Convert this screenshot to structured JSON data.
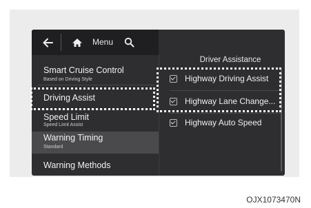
{
  "topbar": {
    "back_icon": "back-arrow-icon",
    "home_icon": "home-icon",
    "menu_label": "Menu",
    "search_icon": "search-icon"
  },
  "left_menu": [
    {
      "label": "Smart Cruise Control",
      "sub": "Based on Driving Style"
    },
    {
      "label": "Driving Assist",
      "sub": ""
    },
    {
      "label": "Speed Limit",
      "sub": "Speed Limit Assist"
    },
    {
      "label": "Warning Timing",
      "sub": "Standard"
    },
    {
      "label": "Warning Methods",
      "sub": ""
    }
  ],
  "right_panel": {
    "title": "Driver Assistance",
    "items": [
      {
        "label": "Highway Driving Assist",
        "checked": true
      },
      {
        "label": "Highway Lane Change...",
        "checked": true
      },
      {
        "label": "Highway Auto Speed",
        "checked": true
      }
    ]
  },
  "caption": "OJX1073470N",
  "colors": {
    "screen_bg": "#2e2e30",
    "highlight": "#4a4a4d",
    "dotted": "#ffffff"
  }
}
